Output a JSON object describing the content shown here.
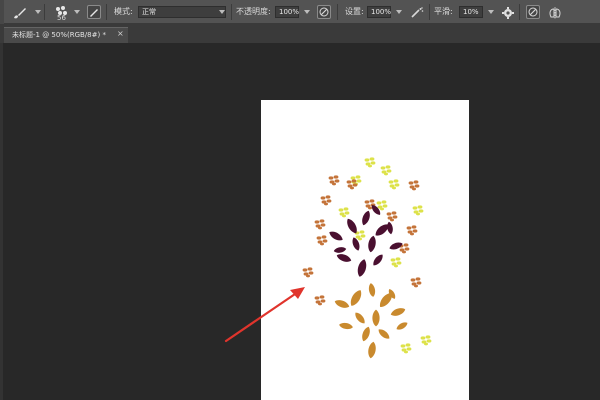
{
  "toolbar": {
    "brush_size": "56",
    "mode_label": "模式:",
    "mode_value": "正常",
    "opacity_label": "不透明度:",
    "opacity_value": "100%",
    "flow_label": "设置:",
    "flow_value": "100%",
    "smoothing_label": "平滑:",
    "smoothing_value": "10%"
  },
  "document_tab": {
    "title": "未标题-1 @ 50%(RGB/8#) *",
    "close_glyph": "×"
  },
  "canvas": {
    "background": "#ffffff"
  },
  "colors": {
    "ui_bar": "#535353",
    "workspace": "#282828",
    "leaf_dark": "#4a1030",
    "leaf_orange": "#c98a2e",
    "leaf_yellow": "#dde24a",
    "leaf_rust": "#c4743a",
    "arrow": "#e0342c"
  },
  "icons": [
    "brush-tool-icon",
    "brush-preset-icon",
    "brush-panel-icon",
    "pressure-opacity-icon",
    "airbrush-icon",
    "settings-gear-icon",
    "pressure-size-icon",
    "symmetry-icon"
  ]
}
